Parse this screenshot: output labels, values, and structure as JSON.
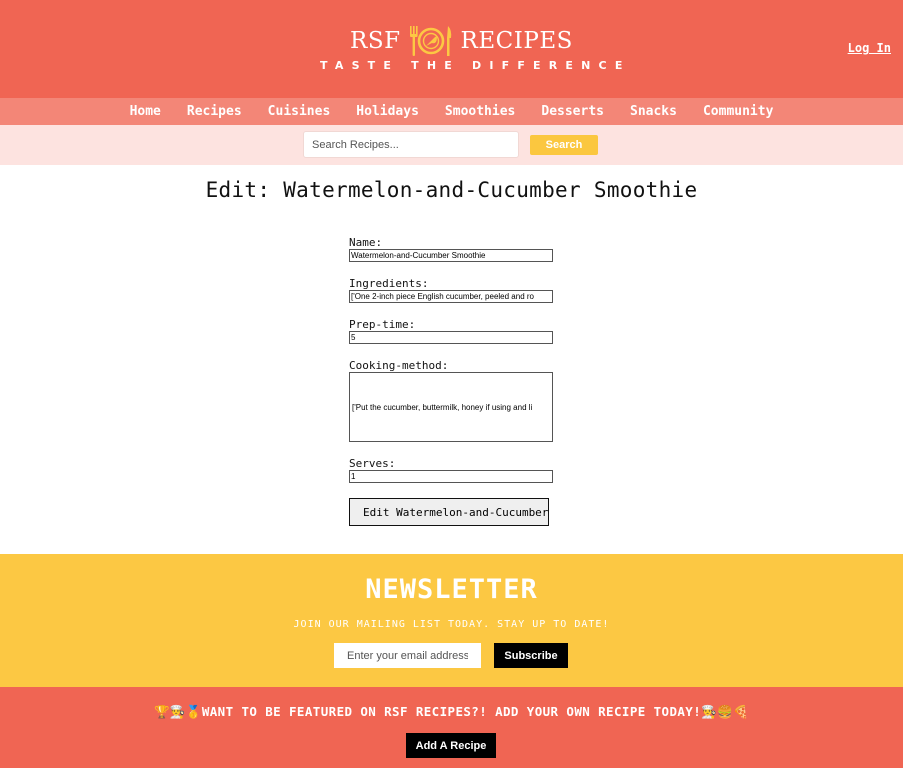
{
  "header": {
    "logo_left": "RSF",
    "logo_right": "RECIPES",
    "tagline": "TASTE THE DIFFERENCE",
    "login_label": "Log In"
  },
  "nav": {
    "items": [
      {
        "label": "Home"
      },
      {
        "label": "Recipes"
      },
      {
        "label": "Cuisines"
      },
      {
        "label": "Holidays"
      },
      {
        "label": "Smoothies"
      },
      {
        "label": "Desserts"
      },
      {
        "label": "Snacks"
      },
      {
        "label": "Community"
      }
    ]
  },
  "search": {
    "placeholder": "Search Recipes...",
    "button_label": "Search"
  },
  "page": {
    "title": "Edit: Watermelon-and-Cucumber Smoothie"
  },
  "form": {
    "name_label": "Name:",
    "name_value": "Watermelon-and-Cucumber Smoothie",
    "ingredients_label": "Ingredients:",
    "ingredients_value": "['One 2-inch piece English cucumber, peeled and ro",
    "preptime_label": "Prep-time:",
    "preptime_value": "5",
    "method_label": "Cooking-method:",
    "method_value": "['Put the cucumber, buttermilk, honey if using and li",
    "serves_label": "Serves:",
    "serves_value": "1",
    "submit_label": "Edit Watermelon-and-Cucumber Smoothie"
  },
  "newsletter": {
    "title": "NEWSLETTER",
    "subtitle": "JOIN OUR MAILING LIST TODAY. STAY UP TO DATE!",
    "email_placeholder": "Enter your email address",
    "subscribe_label": "Subscribe"
  },
  "feature": {
    "text": "🏆👨‍🍳🥇WANT TO BE FEATURED ON RSF RECIPES?! ADD YOUR OWN RECIPE TODAY!👨‍🍳🍔🍕",
    "button_label": "Add A Recipe"
  },
  "colors": {
    "brand_coral": "#f06553",
    "nav_coral": "#f38677",
    "search_bg": "#fde3e0",
    "accent_yellow": "#fcc843"
  },
  "icons": {
    "logo_emblem": "plate-fork-knife-icon"
  }
}
